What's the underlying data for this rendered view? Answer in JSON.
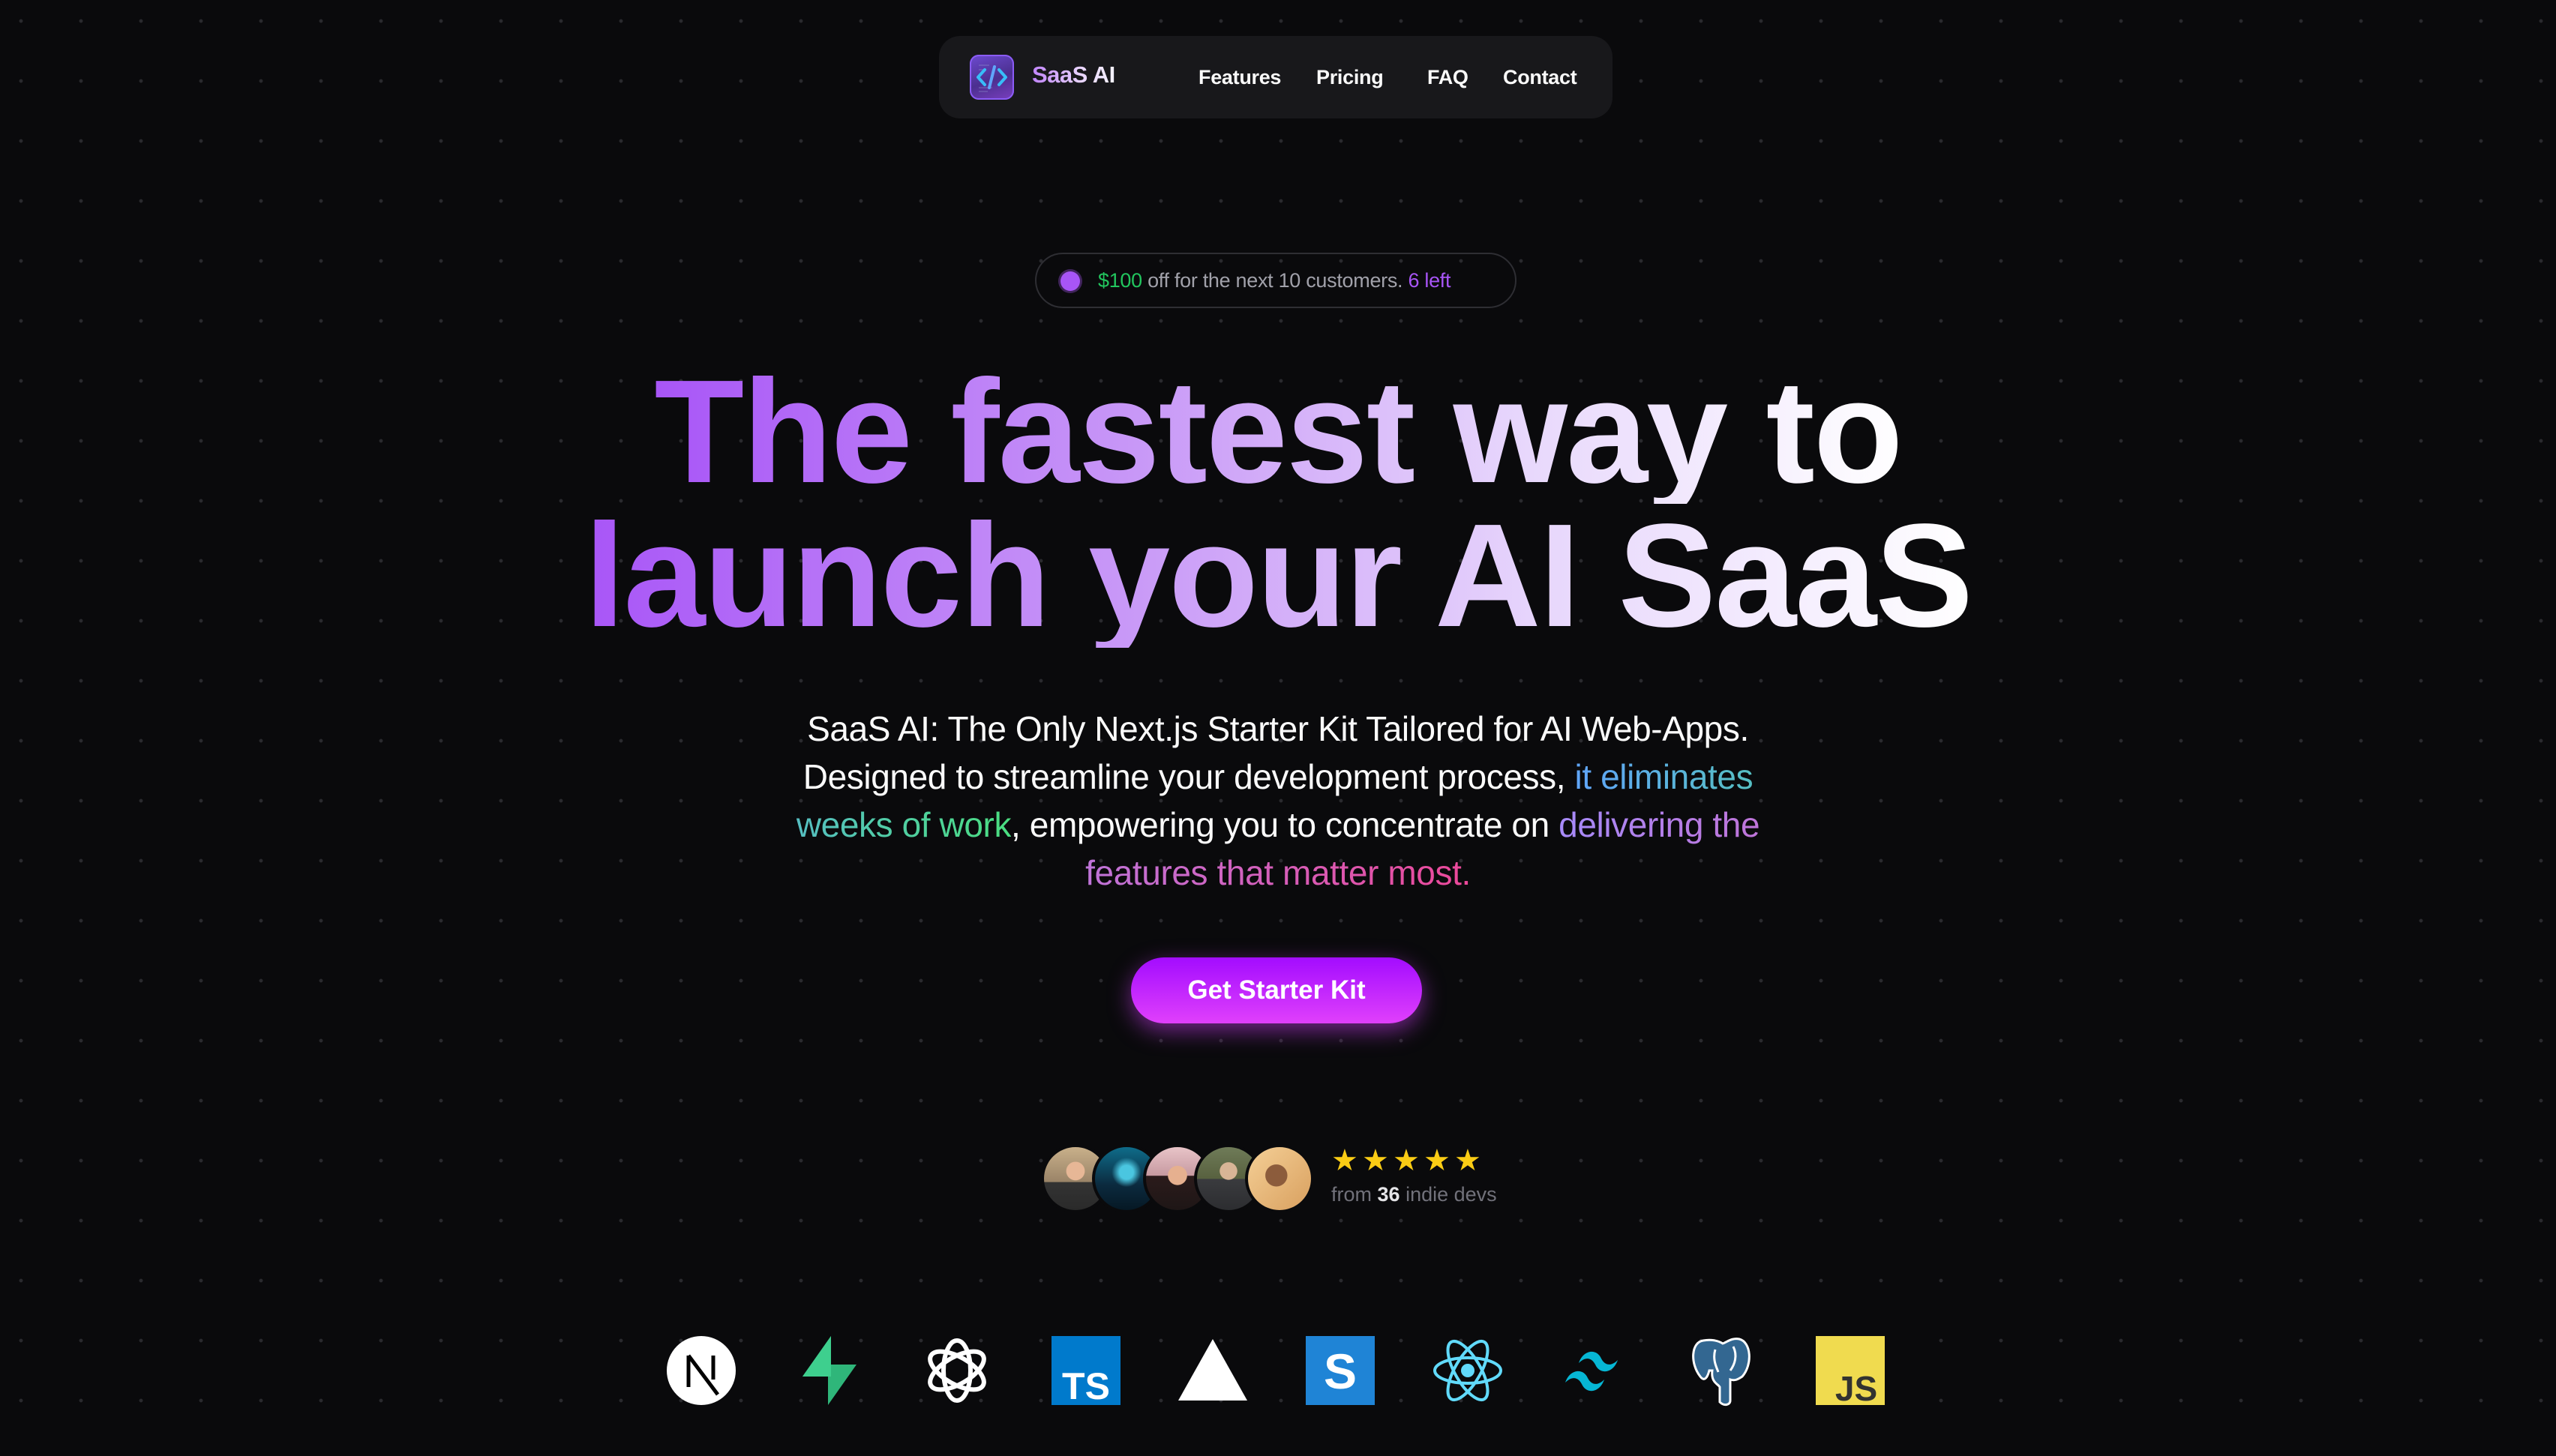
{
  "nav": {
    "brand": "SaaS AI",
    "logo_icon": "code-brackets-icon",
    "links": [
      "Features",
      "Pricing",
      "FAQ",
      "Contact"
    ]
  },
  "badge": {
    "amount": "$100",
    "text": " off for the next 10 customers. ",
    "remaining": "6 left"
  },
  "hero": {
    "headline_line1": "The fastest way to",
    "headline_line2": "launch your AI SaaS",
    "sub_part1": "SaaS AI: The Only Next.js Starter Kit Tailored for AI Web-Apps. Designed to streamline your development process, ",
    "sub_highlight1": "it eliminates weeks of work",
    "sub_part2": ", empowering you to concentrate on ",
    "sub_highlight2": "delivering the features that matter most.",
    "cta_label": "Get Starter Kit"
  },
  "social_proof": {
    "avatar_count": 5,
    "rating": 5,
    "rating_max": 5,
    "prefix": "from ",
    "count": "36",
    "suffix": " indie devs"
  },
  "tech_stack": [
    "Next.js",
    "Supabase",
    "OpenAI",
    "TypeScript",
    "Vercel",
    "Stripe",
    "React",
    "Tailwind CSS",
    "PostgreSQL",
    "JavaScript"
  ],
  "colors": {
    "background": "#0a0a0c",
    "accent_purple": "#a855f7",
    "accent_green": "#22c55e",
    "cta_top": "#a30cff",
    "cta_bottom": "#e040fb",
    "star": "#facc15"
  }
}
